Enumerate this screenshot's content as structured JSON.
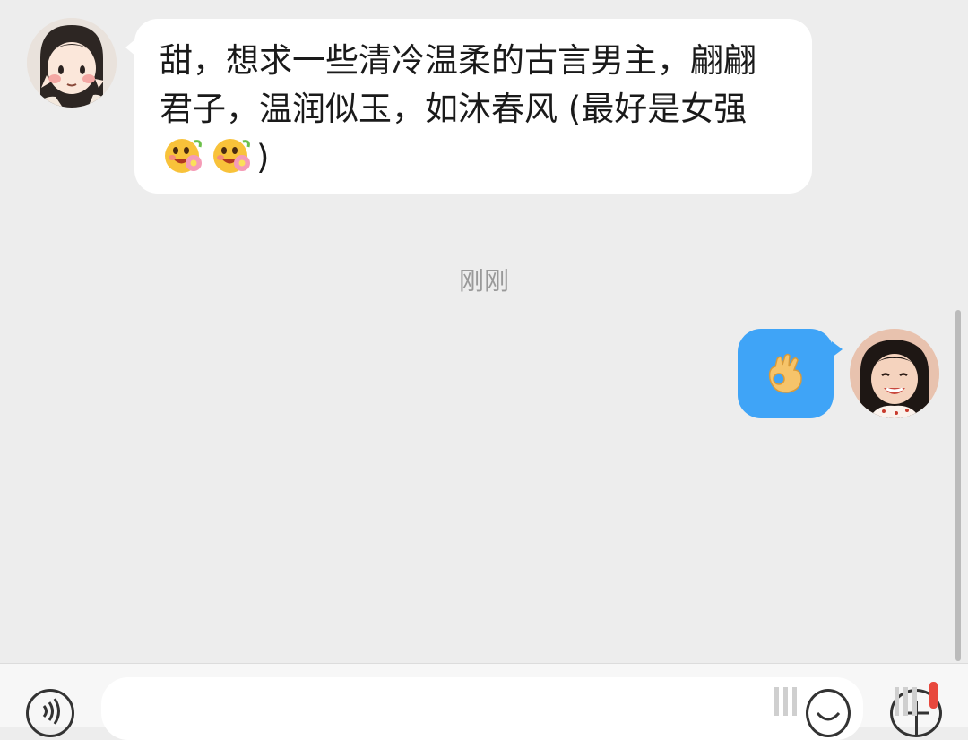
{
  "conversation": {
    "incoming_message": {
      "text": "甜，想求一些清冷温柔的古言男主，翩翩君子，温润似玉，如沐春风 (最好是女强",
      "emoji": "blush-flower-emoji",
      "emoji_count": 2,
      "closing": ")"
    },
    "timestamp": "刚刚",
    "outgoing_message": {
      "emoji": "ok-hand-emoji"
    }
  },
  "composer": {
    "voice_icon": "voice-icon",
    "emoji_icon": "emoji-icon",
    "plus_icon": "plus-icon"
  },
  "colors": {
    "outgoing_bubble": "#3fa4f7",
    "incoming_bubble": "#ffffff",
    "background": "#ededed",
    "notification_dot": "#e8483d"
  }
}
